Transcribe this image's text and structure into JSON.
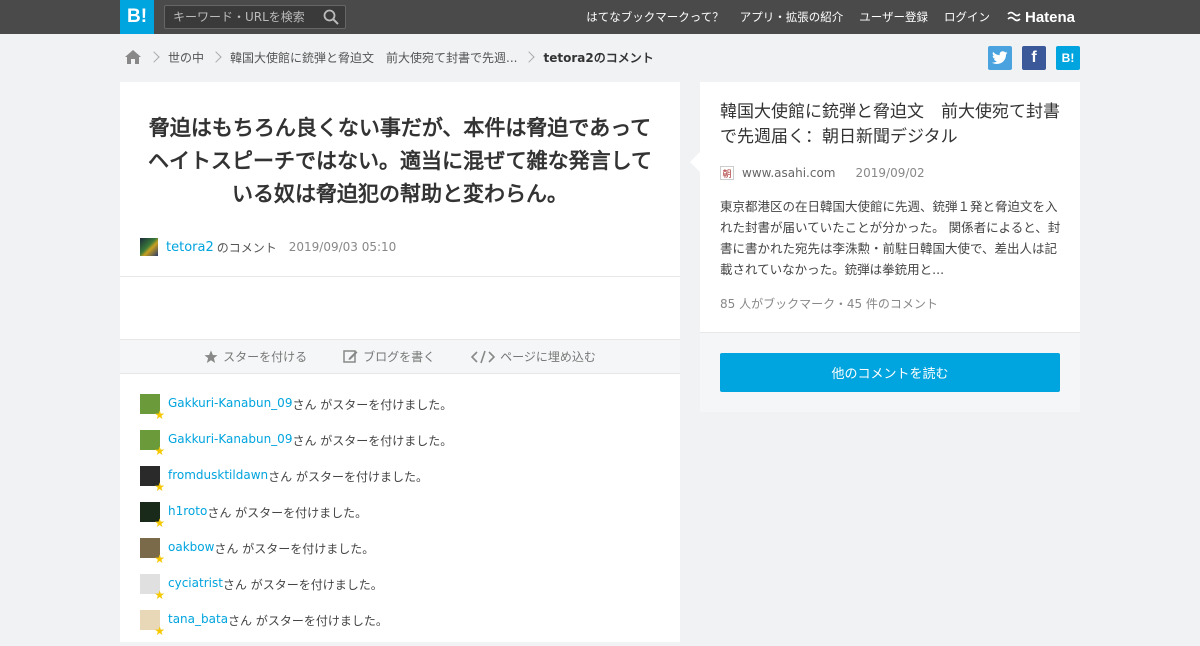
{
  "header": {
    "logo": "B!",
    "search_placeholder": "キーワード・URLを検索",
    "nav": [
      "はてなブックマークって？",
      "アプリ・拡張の紹介",
      "ユーザー登録",
      "ログイン"
    ],
    "brand": "Hatena"
  },
  "breadcrumb": {
    "items": [
      "世の中",
      "韓国大使館に銃弾と脅迫文　前大使宛て封書で先週..."
    ],
    "current": "tetora2のコメント"
  },
  "share": {
    "twitter": "t",
    "facebook": "f",
    "hatebu": "B!"
  },
  "comment": {
    "text": "脅迫はもちろん良くない事だが、本件は脅迫であってヘイトスピーチではない。適当に混ぜて雑な発言している奴は脅迫犯の幇助と変わらん。",
    "user": "tetora2",
    "suffix": "のコメント",
    "date": "2019/09/03 05:10"
  },
  "actions": {
    "star": "スターを付ける",
    "blog": "ブログを書く",
    "embed": "ページに埋め込む"
  },
  "stars": {
    "suffix": "さん がスターを付けました。",
    "users": [
      {
        "name": "Gakkuri-Kanabun_09",
        "color": "#6a9a3a"
      },
      {
        "name": "Gakkuri-Kanabun_09",
        "color": "#6a9a3a"
      },
      {
        "name": "fromdusktildawn",
        "color": "#2a2a2a"
      },
      {
        "name": "h1roto",
        "color": "#1a2a1a"
      },
      {
        "name": "oakbow",
        "color": "#7a6a4a"
      },
      {
        "name": "cyciatrist",
        "color": "#e0e0e0"
      },
      {
        "name": "tana_bata",
        "color": "#e8d8b8"
      }
    ]
  },
  "entry": {
    "title": "韓国大使館に銃弾と脅迫文　前大使宛て封書で先週届く：朝日新聞デジタル",
    "domain": "www.asahi.com",
    "date": "2019/09/02",
    "summary": "東京都港区の在日韓国大使館に先週、銃弾１発と脅迫文を入れた封書が届いていたことが分かった。 関係者によると、封書に書かれた宛先は李洙勲・前駐日韓国大使で、差出人は記載されていなかった。銃弾は拳銃用と...",
    "counts": "85 人がブックマーク・45 件のコメント",
    "read_more": "他のコメントを読む"
  }
}
